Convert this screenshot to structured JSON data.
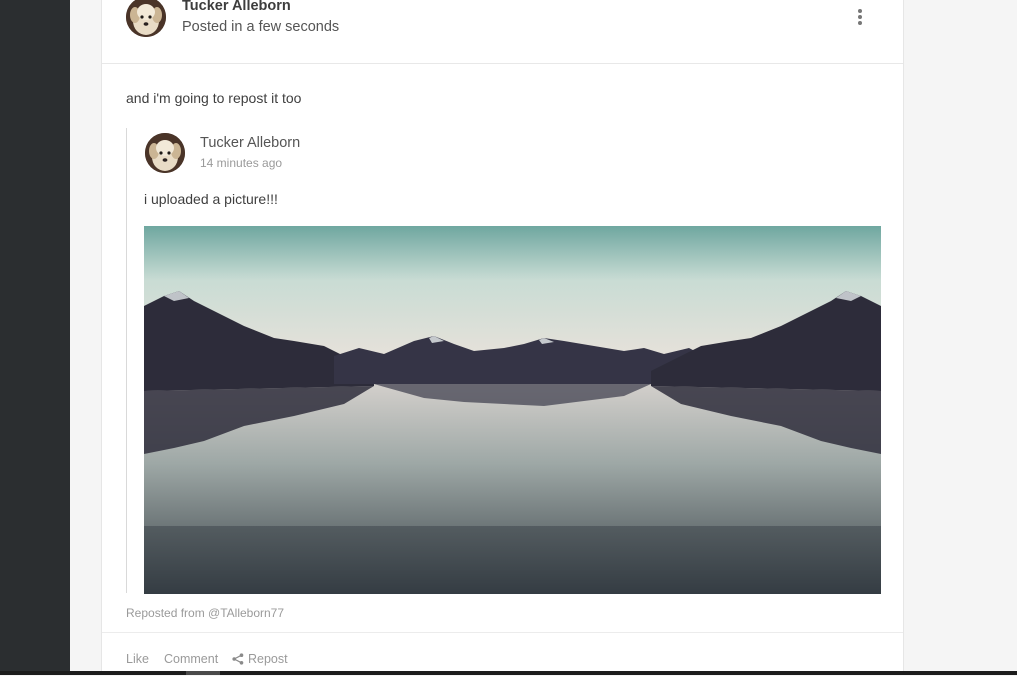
{
  "post": {
    "author_name": "Tucker Alleborn",
    "posted_time": "Posted in a few seconds",
    "text": "and i'm going to repost it too",
    "more_icon": "more-vertical-icon"
  },
  "repost": {
    "author_name": "Tucker Alleborn",
    "time": "14 minutes ago",
    "text": "i uploaded a picture!!!",
    "image_description_icon": "landscape-image",
    "source": "Reposted from @TAlleborn77"
  },
  "actions": {
    "like": "Like",
    "comment": "Comment",
    "repost": "Repost",
    "repost_icon": "share-icon"
  },
  "colors": {
    "sidebar": "#2b2e30",
    "background": "#f5f5f5",
    "card": "#ffffff",
    "muted_text": "#9a9a9a"
  }
}
